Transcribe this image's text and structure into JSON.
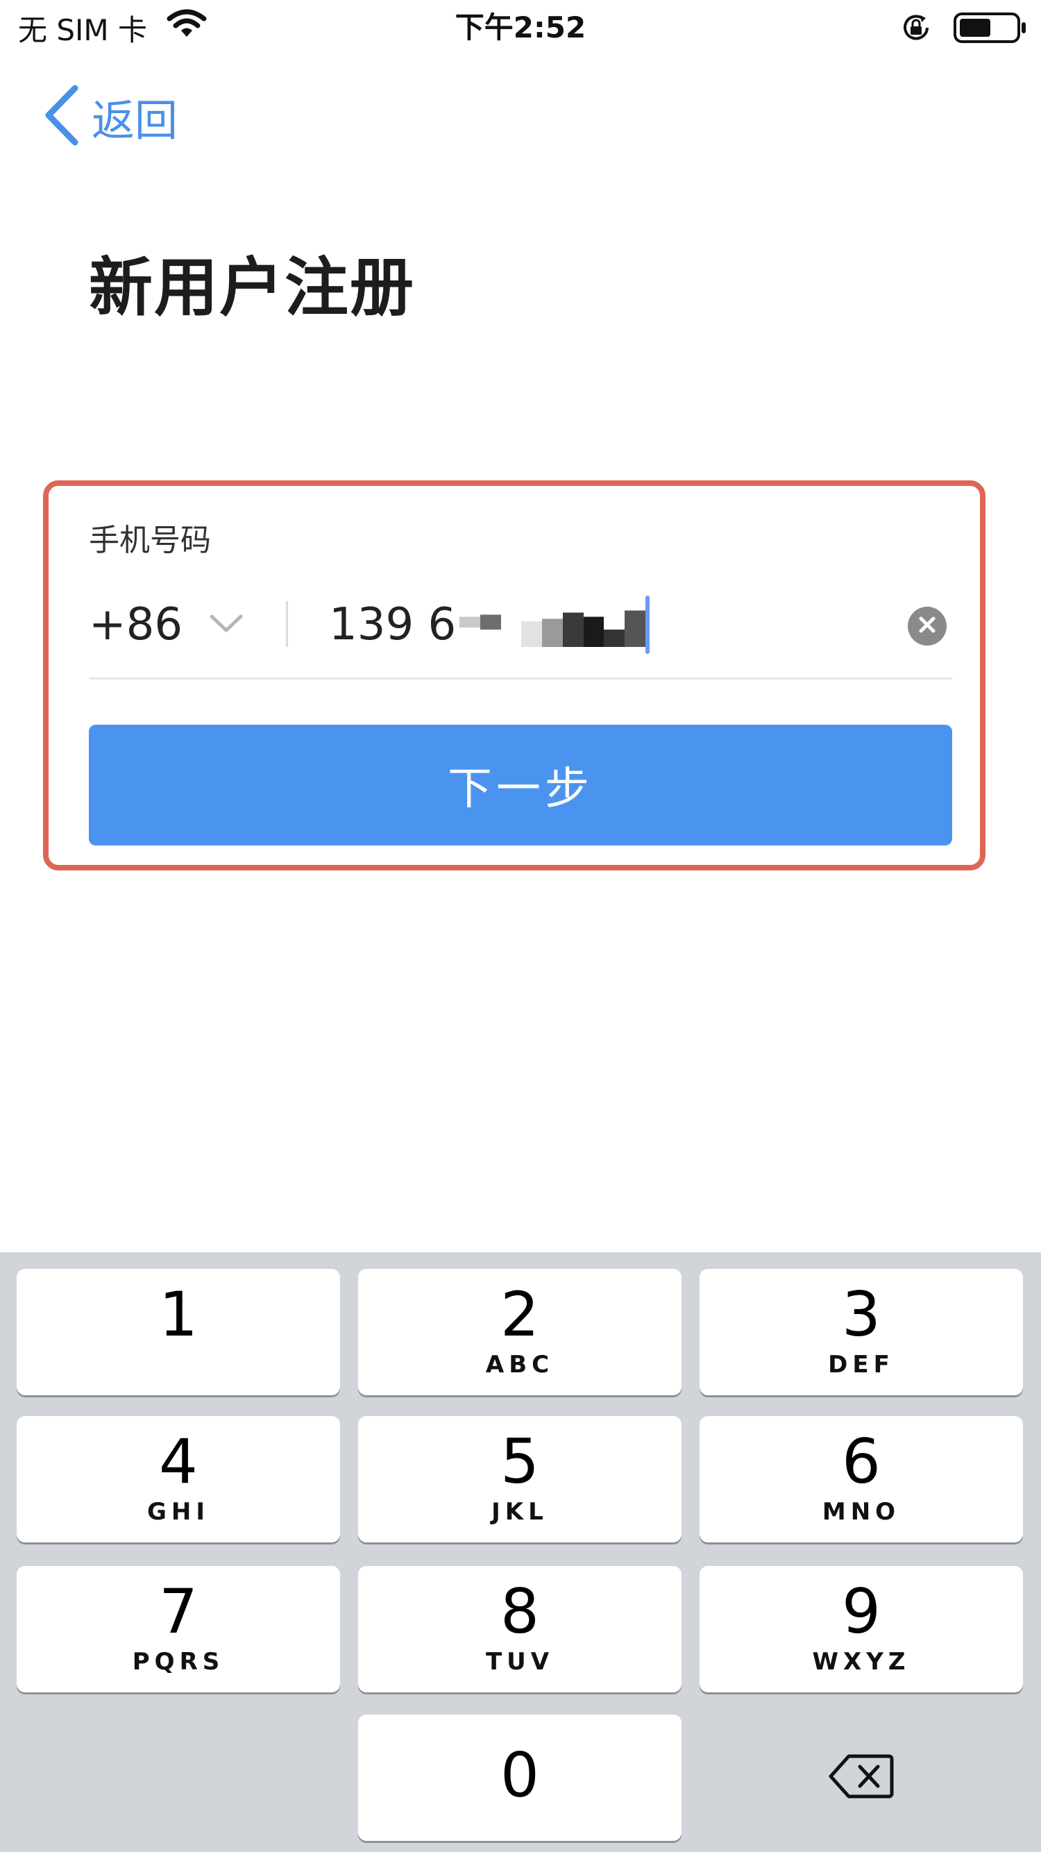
{
  "status_bar": {
    "carrier": "无 SIM 卡",
    "time": "下午2:52"
  },
  "nav": {
    "back_label": "返回"
  },
  "page": {
    "title": "新用户注册"
  },
  "form": {
    "phone_label": "手机号码",
    "country_code": "+86",
    "phone_value": "139 67",
    "next_label": "下一步"
  },
  "keyboard": {
    "keys": [
      {
        "digit": "1",
        "letters": ""
      },
      {
        "digit": "2",
        "letters": "ABC"
      },
      {
        "digit": "3",
        "letters": "DEF"
      },
      {
        "digit": "4",
        "letters": "GHI"
      },
      {
        "digit": "5",
        "letters": "JKL"
      },
      {
        "digit": "6",
        "letters": "MNO"
      },
      {
        "digit": "7",
        "letters": "PQRS"
      },
      {
        "digit": "8",
        "letters": "TUV"
      },
      {
        "digit": "9",
        "letters": "WXYZ"
      },
      {
        "digit": "0",
        "letters": ""
      }
    ]
  },
  "colors": {
    "accent": "#4a94f0",
    "highlight_border": "#df6656",
    "keyboard_bg": "#d1d4d9"
  }
}
